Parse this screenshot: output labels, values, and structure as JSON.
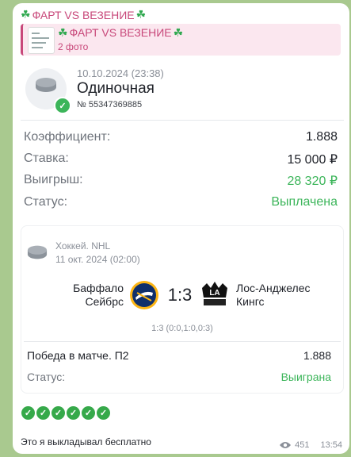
{
  "channel": {
    "title": "ФАРТ VS ВЕЗЕНИЕ",
    "clover": "☘"
  },
  "reply": {
    "title": "ФАРТ VS ВЕЗЕНИЕ",
    "subtitle": "2 фото"
  },
  "bet": {
    "date": "10.10.2024 (23:38)",
    "type": "Одиночная",
    "number": "№ 55347369885",
    "rows": [
      {
        "label": "Коэффициент:",
        "value": "1.888"
      },
      {
        "label": "Ставка:",
        "value": "15 000 ₽"
      },
      {
        "label": "Выигрыш:",
        "value": "28 320 ₽"
      },
      {
        "label": "Статус:",
        "value": "Выплачена"
      }
    ]
  },
  "event": {
    "league": "Хоккей. NHL",
    "date": "11 окт. 2024 (02:00)",
    "team1": "Баффало Сейбрс",
    "team2": "Лос-Анджелес Кингс",
    "score": "1:3",
    "periods": "1:3 (0:0,1:0,0:3)",
    "pick_label": "Победа в матче. П2",
    "pick_odds": "1.888",
    "status_label": "Статус:",
    "status_value": "Выиграна"
  },
  "message": {
    "caption": "Это я выкладывал бесплатно",
    "views": "451",
    "time": "13:54"
  },
  "colors": {
    "accent": "#c8487a",
    "green": "#3cb55a"
  }
}
